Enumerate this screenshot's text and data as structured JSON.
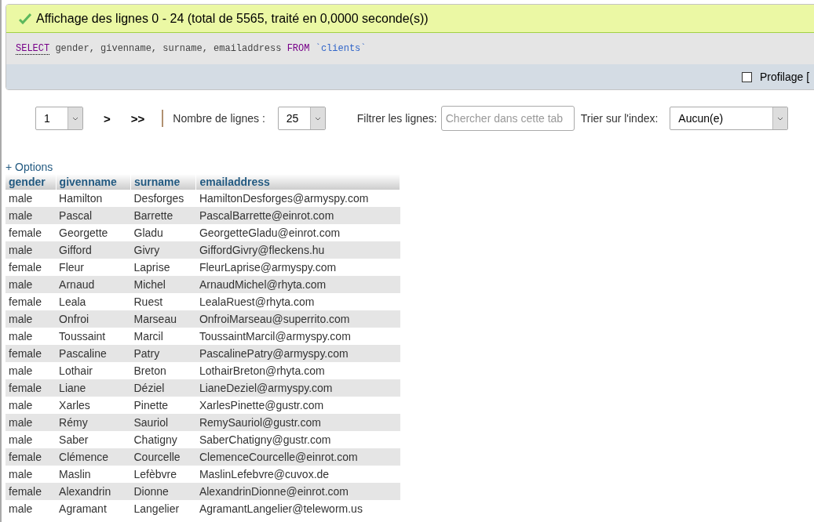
{
  "message": {
    "text": "Affichage des lignes 0 - 24 (total de 5565, traité en 0,0000 seconde(s))"
  },
  "sql": {
    "keyword_select": "SELECT",
    "columns_text": "gender, givenname, surname, emailaddress",
    "keyword_from": "FROM",
    "table": "`clients`"
  },
  "profiling": {
    "label": "Profilage [",
    "checked": false
  },
  "navigation": {
    "page": "1",
    "next": ">",
    "last": ">>",
    "rows_label": "Nombre de lignes :",
    "rows_value": "25",
    "filter_label": "Filtrer les lignes:",
    "filter_placeholder": "Chercher dans cette tab",
    "sort_label": "Trier sur l'index:",
    "sort_value": "Aucun(e)"
  },
  "options_link": "+ Options",
  "table": {
    "columns": [
      "gender",
      "givenname",
      "surname",
      "emailaddress"
    ],
    "rows": [
      [
        "male",
        "Hamilton",
        "Desforges",
        "HamiltonDesforges@armyspy.com"
      ],
      [
        "male",
        "Pascal",
        "Barrette",
        "PascalBarrette@einrot.com"
      ],
      [
        "female",
        "Georgette",
        "Gladu",
        "GeorgetteGladu@einrot.com"
      ],
      [
        "male",
        "Gifford",
        "Givry",
        "GiffordGivry@fleckens.hu"
      ],
      [
        "female",
        "Fleur",
        "Laprise",
        "FleurLaprise@armyspy.com"
      ],
      [
        "male",
        "Arnaud",
        "Michel",
        "ArnaudMichel@rhyta.com"
      ],
      [
        "female",
        "Leala",
        "Ruest",
        "LealaRuest@rhyta.com"
      ],
      [
        "male",
        "Onfroi",
        "Marseau",
        "OnfroiMarseau@superrito.com"
      ],
      [
        "male",
        "Toussaint",
        "Marcil",
        "ToussaintMarcil@armyspy.com"
      ],
      [
        "female",
        "Pascaline",
        "Patry",
        "PascalinePatry@armyspy.com"
      ],
      [
        "male",
        "Lothair",
        "Breton",
        "LothairBreton@rhyta.com"
      ],
      [
        "female",
        "Liane",
        "Déziel",
        "LianeDeziel@armyspy.com"
      ],
      [
        "male",
        "Xarles",
        "Pinette",
        "XarlesPinette@gustr.com"
      ],
      [
        "male",
        "Rémy",
        "Sauriol",
        "RemySauriol@gustr.com"
      ],
      [
        "male",
        "Saber",
        "Chatigny",
        "SaberChatigny@gustr.com"
      ],
      [
        "female",
        "Clémence",
        "Courcelle",
        "ClemenceCourcelle@einrot.com"
      ],
      [
        "male",
        "Maslin",
        "Lefèbvre",
        "MaslinLefebvre@cuvox.de"
      ],
      [
        "female",
        "Alexandrin",
        "Dionne",
        "AlexandrinDionne@einrot.com"
      ],
      [
        "male",
        "Agramant",
        "Langelier",
        "AgramantLangelier@teleworm.us"
      ]
    ]
  }
}
